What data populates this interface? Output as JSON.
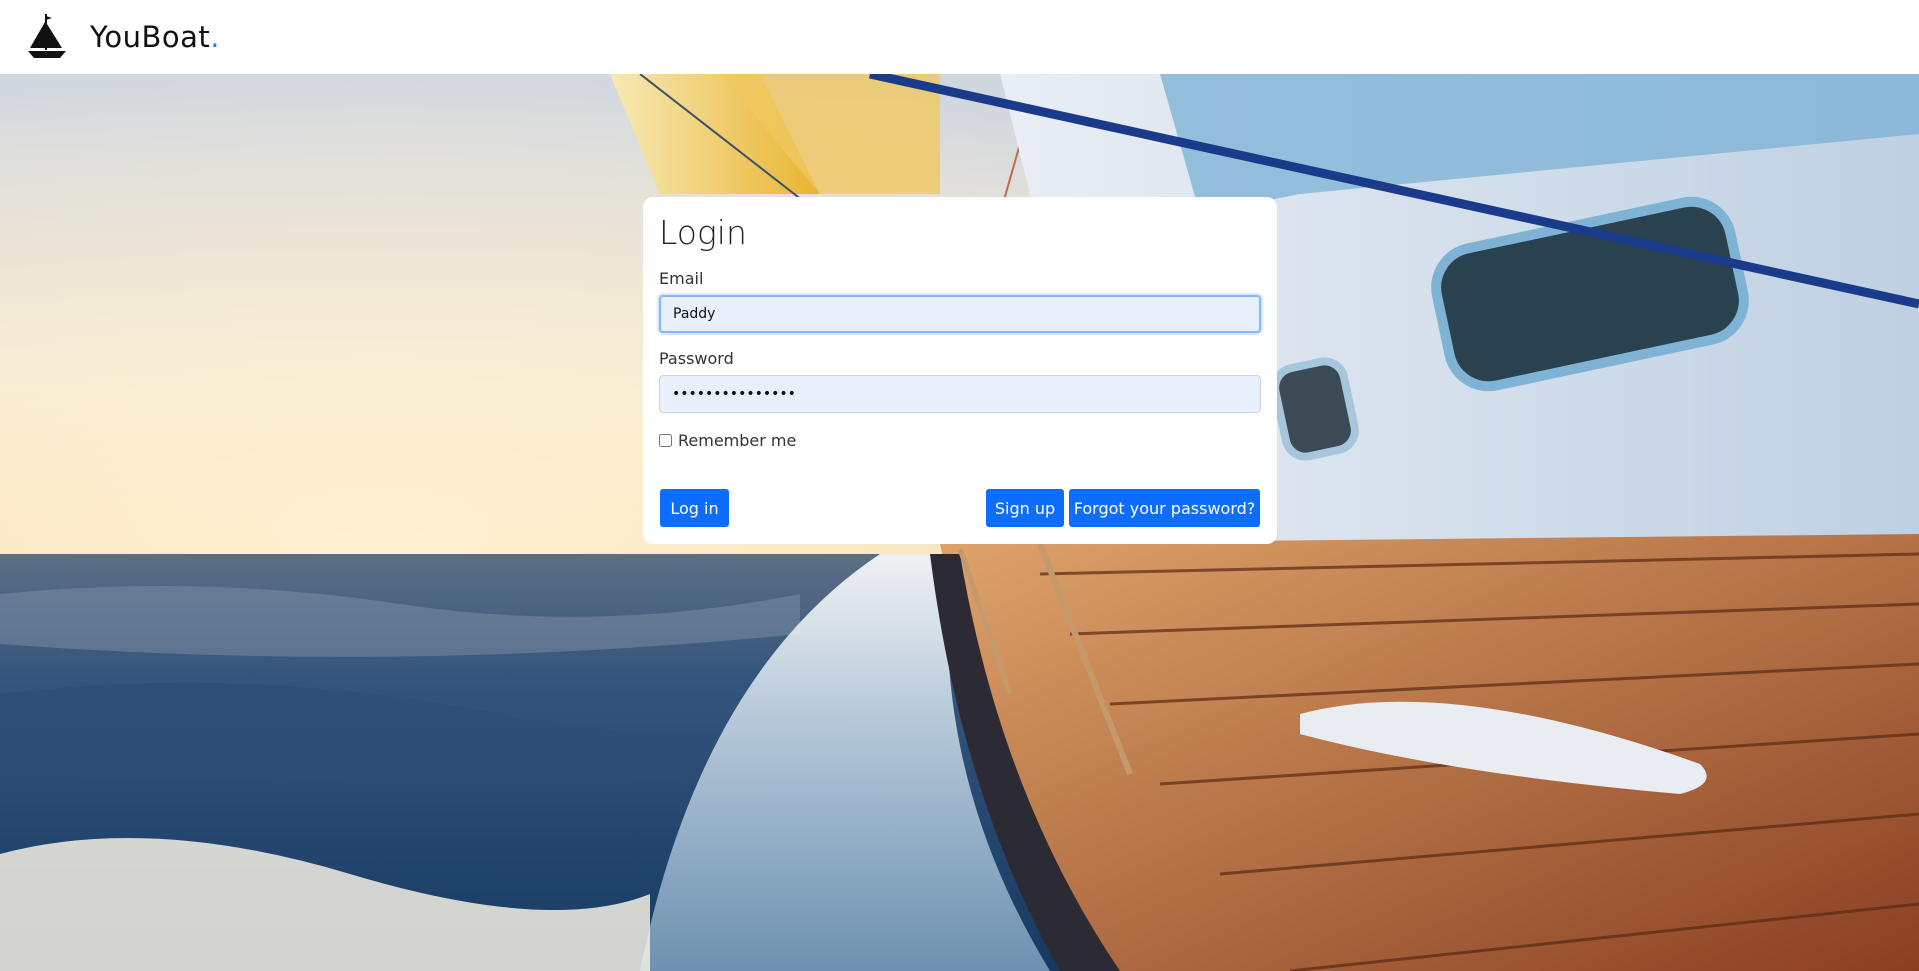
{
  "brand": {
    "name": "YouBoat",
    "dot": ".",
    "logo_icon": "sailboat-icon",
    "accent_color": "#1e88e5"
  },
  "login": {
    "title": "Login",
    "email_label": "Email",
    "email_value": "Paddy",
    "password_label": "Password",
    "password_value": "•••••••••••••••",
    "remember_label": "Remember me",
    "remember_checked": false,
    "login_button": "Log in",
    "signup_button": "Sign up",
    "forgot_button": "Forgot your password?",
    "button_color": "#0d6efd"
  }
}
